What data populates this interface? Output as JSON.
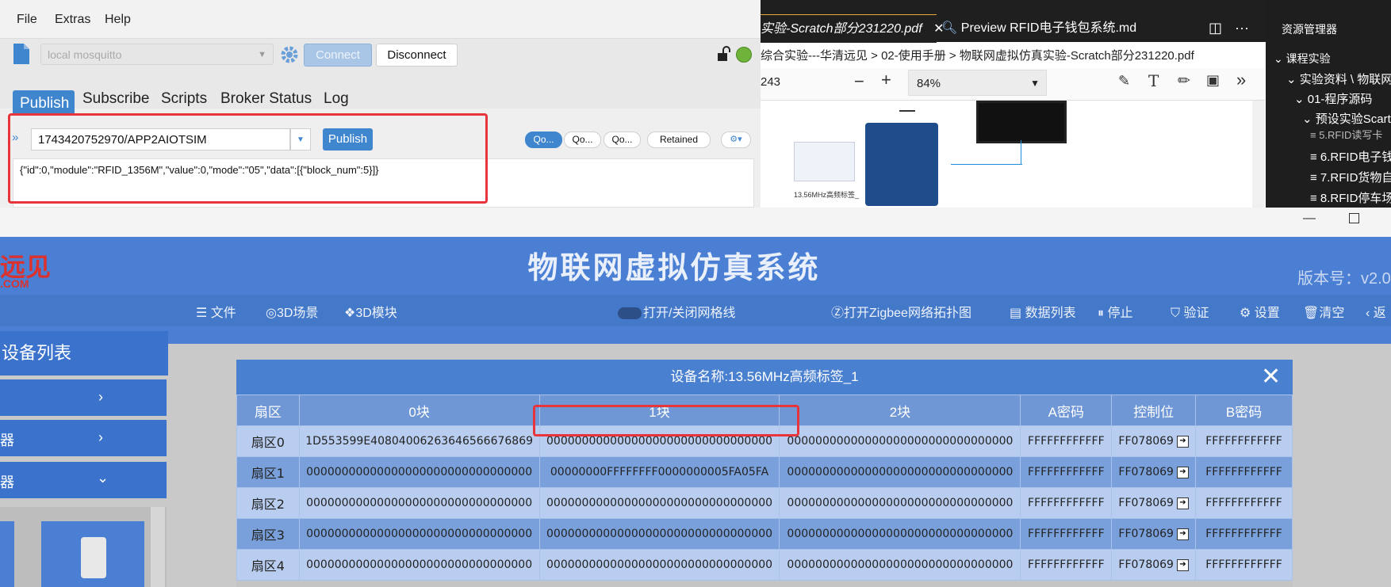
{
  "mqtt": {
    "menu": [
      "File",
      "Extras",
      "Help"
    ],
    "profile": "local mosquitto",
    "connect_label": "Connect",
    "disconnect_label": "Disconnect",
    "tabs": [
      "Publish",
      "Subscribe",
      "Scripts",
      "Broker Status",
      "Log"
    ],
    "topic": "1743420752970/APP2AIOTSIM",
    "publish_label": "Publish",
    "qos": [
      "Qo...",
      "Qo...",
      "Qo..."
    ],
    "retained_label": "Retained",
    "payload": "{\"id\":0,\"module\":\"RFID_1356M\",\"value\":0,\"mode\":\"05\",\"data\":[{\"block_num\":5}]}"
  },
  "editor": {
    "tab1": "实验-Scratch部分231220.pdf",
    "tab2": "Preview RFID电子钱包系统.md",
    "breadcrumb": "综合实验---华清远见 > 02-使用手册 > 物联网虚拟仿真实验-Scratch部分231220.pdf",
    "page_num": "243",
    "zoom": "84%",
    "thumb_caption": "13.56MHz高频标签_",
    "explorer": {
      "title": "资源管理器",
      "items": [
        "课程实验",
        "实验资料 \\ 物联网",
        "01-程序源码",
        "预设实验Scart",
        "5.RFID读写卡",
        "6.RFID电子钱",
        "7.RFID货物自",
        "8.RFID停车场"
      ]
    }
  },
  "sim": {
    "title": "物联网虚拟仿真系统",
    "version": "版本号：v2.0",
    "logo_top": "远见",
    "logo_bottom": ".COM",
    "nav": [
      "文件",
      "3D场景",
      "3D模块",
      "打开/关闭网格线",
      "打开Zigbee网络拓扑图",
      "数据列表",
      "停止",
      "验证",
      "设置",
      "清空",
      "返"
    ],
    "sidebar": {
      "header": "设备列表",
      "items": [
        "",
        "器",
        "器"
      ]
    },
    "dialog_title": "设备名称:13.56MHz高频标签_1",
    "table": {
      "headers": [
        "扇区",
        "0块",
        "1块",
        "2块",
        "A密码",
        "控制位",
        "B密码"
      ],
      "rows": [
        [
          "扇区0",
          "1D553599E408040062636465666768 69",
          "00000000000000000000000000000000",
          "00000000000000000000000000000000",
          "FFFFFFFFFFFF",
          "FF078069",
          "FFFFFFFFFFFF"
        ],
        [
          "扇区1",
          "00000000000000000000000000000000",
          "00000000FFFFFFFF0000000005FA05FA",
          "00000000000000000000000000000000",
          "FFFFFFFFFFFF",
          "FF078069",
          "FFFFFFFFFFFF"
        ],
        [
          "扇区2",
          "00000000000000000000000000000000",
          "00000000000000000000000000000000",
          "00000000000000000000000000000000",
          "FFFFFFFFFFFF",
          "FF078069",
          "FFFFFFFFFFFF"
        ],
        [
          "扇区3",
          "00000000000000000000000000000000",
          "00000000000000000000000000000000",
          "00000000000000000000000000000000",
          "FFFFFFFFFFFF",
          "FF078069",
          "FFFFFFFFFFFF"
        ],
        [
          "扇区4",
          "00000000000000000000000000000000",
          "00000000000000000000000000000000",
          "00000000000000000000000000000000",
          "FFFFFFFFFFFF",
          "FF078069",
          "FFFFFFFFFFFF"
        ]
      ]
    }
  },
  "colors": {
    "accent_blue": "#3f86cf",
    "highlight_red": "#e8343b",
    "sim_banner": "#4a7fd4"
  }
}
